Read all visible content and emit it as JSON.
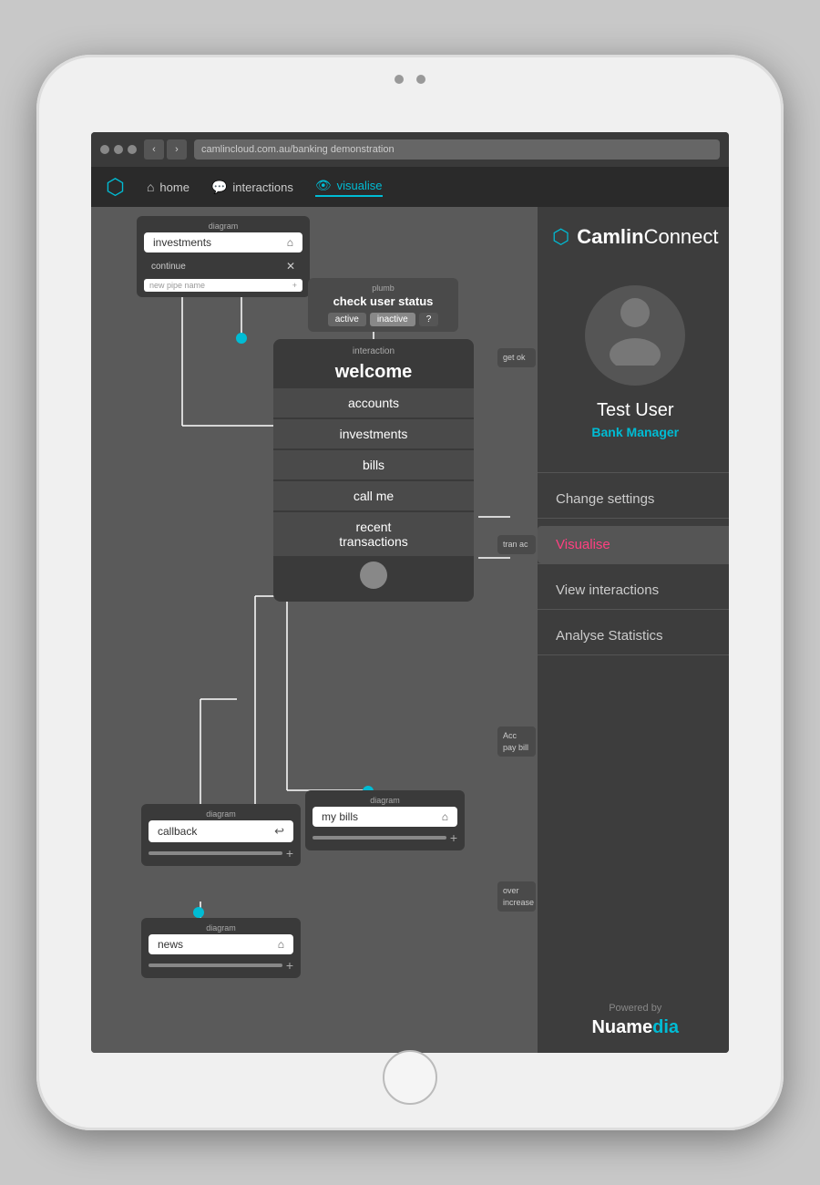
{
  "tablet": {
    "browser": {
      "url": "camlincloud.com.au/banking demonstration",
      "back": "‹",
      "forward": "›"
    },
    "nav": {
      "logo": "⬡",
      "items": [
        {
          "id": "home",
          "label": "home",
          "icon": "⌂",
          "active": false
        },
        {
          "id": "interactions",
          "label": "interactions",
          "icon": "💬",
          "active": false
        },
        {
          "id": "visualise",
          "label": "visualise",
          "icon": "👁",
          "active": true
        }
      ]
    },
    "diagram": {
      "investments_node": {
        "label": "diagram",
        "name": "investments",
        "continue": "continue",
        "pipe_placeholder": "new pipe name"
      },
      "check_user": {
        "plumb_label": "plumb",
        "title": "check user status",
        "buttons": [
          "active",
          "inactive",
          "?"
        ]
      },
      "welcome_block": {
        "interaction_label": "interaction",
        "title": "welcome",
        "menu_items": [
          "accounts",
          "investments",
          "bills",
          "call me",
          "recent\ntransactions"
        ]
      },
      "callback_node": {
        "label": "diagram",
        "name": "callback"
      },
      "mybills_node": {
        "label": "diagram",
        "name": "my bills"
      },
      "news_node": {
        "label": "diagram",
        "name": "news"
      },
      "partial_cards": [
        {
          "text": "get\nok"
        },
        {
          "text": "tran\nac"
        },
        {
          "text": "Acc\npay bill"
        },
        {
          "text": "over\nincrease"
        }
      ]
    },
    "right_panel": {
      "brand": {
        "icon": "⬡",
        "name_bold": "Camlin",
        "name_light": "Connect"
      },
      "profile": {
        "name": "Test User",
        "role": "Bank Manager"
      },
      "menu": [
        {
          "id": "change-settings",
          "label": "Change settings",
          "active": false
        },
        {
          "id": "visualise",
          "label": "Visualise",
          "active": true
        },
        {
          "id": "view-interactions",
          "label": "View interactions",
          "active": false
        },
        {
          "id": "analyse-statistics",
          "label": "Analyse Statistics",
          "active": false
        }
      ],
      "footer": {
        "powered_by": "Powered by",
        "brand": "Nuamedia",
        "brand_accent": "ia"
      }
    }
  }
}
